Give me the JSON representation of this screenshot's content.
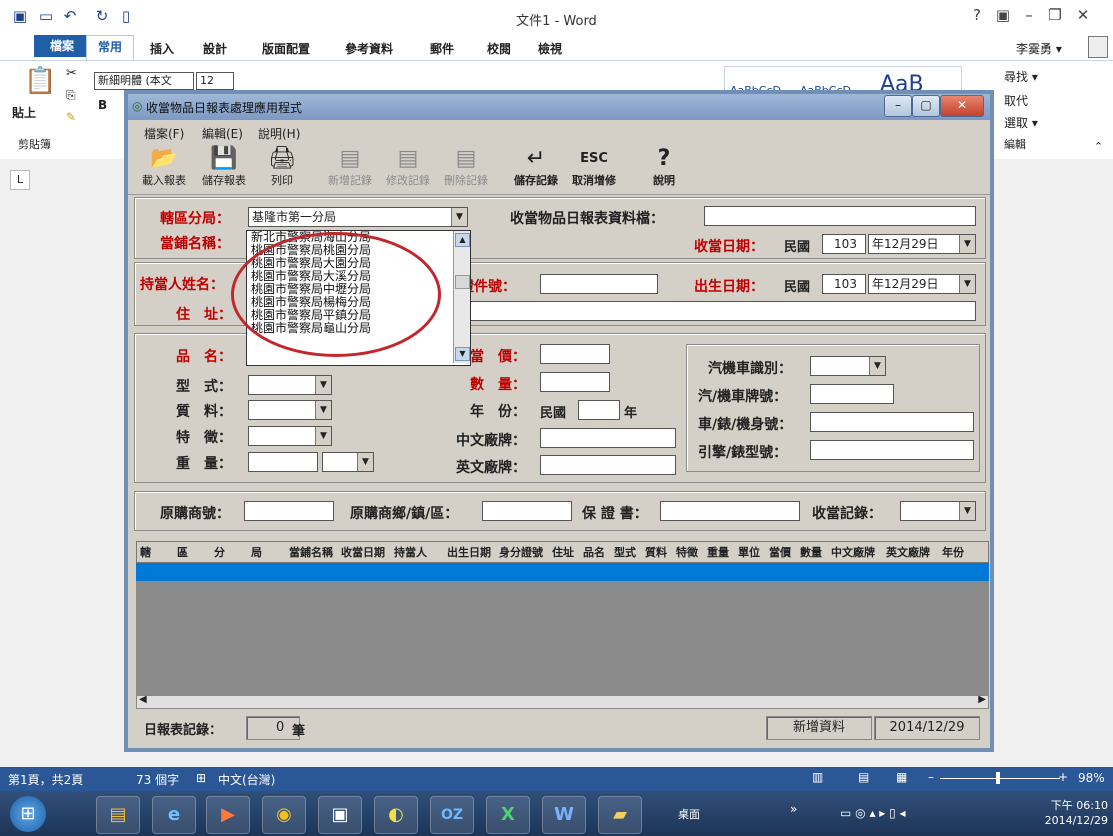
{
  "word": {
    "title": "文件1 - Word",
    "help": "?",
    "user": "李霙勇 ▾",
    "tabs": [
      "檔案",
      "常用",
      "插入",
      "設計",
      "版面配置",
      "參考資料",
      "郵件",
      "校閱",
      "檢視"
    ],
    "font_name": "新細明體 (本文",
    "font_size": "12",
    "paste_label": "貼上",
    "clipboard_label": "剪貼簿",
    "styles": [
      "AaBbCcD",
      "AaBbCcD",
      "AaB"
    ],
    "find_label": "尋找 ▾",
    "replace_label": "取代",
    "select_label": "選取 ▾",
    "edit_label": "編輯",
    "status": {
      "page": "第1頁，共2頁",
      "words": "73 個字",
      "lang": "中文(台灣)",
      "zoom": "98%"
    },
    "clock_time": "下午 06:10",
    "clock_date": "2014/12/29",
    "tray_label": "桌面"
  },
  "app": {
    "title": "收當物品日報表處理應用程式",
    "menu": [
      "檔案(F)",
      "編輯(E)",
      "說明(H)"
    ],
    "toolbar": [
      {
        "label": "載入報表",
        "icon": "📂"
      },
      {
        "label": "儲存報表",
        "icon": "💾"
      },
      {
        "label": "列印",
        "icon": "🖨"
      },
      {
        "label": "新增記錄",
        "icon": "▤"
      },
      {
        "label": "修改記錄",
        "icon": "▤"
      },
      {
        "label": "刪除記錄",
        "icon": "▤"
      },
      {
        "label": "儲存記錄",
        "icon": "↵"
      },
      {
        "label": "取消增修",
        "icon": "ESC"
      },
      {
        "label": "說明",
        "icon": "?"
      }
    ],
    "form": {
      "district_label": "轄區分局：",
      "district_value": "基隆市第一分局",
      "file_label": "收當物品日報表資料檔：",
      "shop_label": "當鋪名稱：",
      "pawn_date_label": "收當日期：",
      "pawn_era": "民國",
      "pawn_year": "103",
      "pawn_md": "年12月29日",
      "holder_label": "持當人姓名：",
      "id_label": "證件號：",
      "birth_label": "出生日期：",
      "birth_era": "民國",
      "birth_year": "103",
      "birth_md": "年12月29日",
      "addr_label": "住　址：",
      "item_label": "品　名：",
      "type_label": "型　式：",
      "material_label": "質　料：",
      "feature_label": "特　徵：",
      "weight_label": "重　量：",
      "price_label": "當　價：",
      "qty_label": "數　量：",
      "year_label": "年　份：",
      "year_era": "民國",
      "year_suffix": "年",
      "cn_brand_label": "中文廠牌：",
      "en_brand_label": "英文廠牌：",
      "vehicle_id_label": "汽機車識別：",
      "plate_label": "汽/機車牌號：",
      "body_no_label": "車/錶/機身號：",
      "engine_label": "引擎/錶型號：",
      "orig_shop_label": "原購商號：",
      "orig_town_label": "原購商鄉/鎮/區：",
      "warranty_label": "保 證 書：",
      "record_label": "收當記錄："
    },
    "dropdown_options": [
      "新北市警察局海山分局",
      "桃園市警察局桃園分局",
      "桃園市警察局大園分局",
      "桃園市警察局大溪分局",
      "桃園市警察局中壢分局",
      "桃園市警察局楊梅分局",
      "桃園市警察局平鎮分局",
      "桃園市警察局龜山分局"
    ],
    "grid_columns": [
      "轄",
      "區",
      "分",
      "局",
      "當鋪名稱",
      "收當日期",
      "持當人",
      "出生日期",
      "身分證號",
      "住址",
      "品名",
      "型式",
      "質料",
      "特徵",
      "重量",
      "單位",
      "當價",
      "數量",
      "中文廠牌",
      "英文廠牌",
      "年份"
    ],
    "footer": {
      "count_label": "日報表記錄：",
      "count": "0",
      "count_unit": "筆",
      "mode": "新增資料",
      "date": "2014/12/29"
    }
  }
}
